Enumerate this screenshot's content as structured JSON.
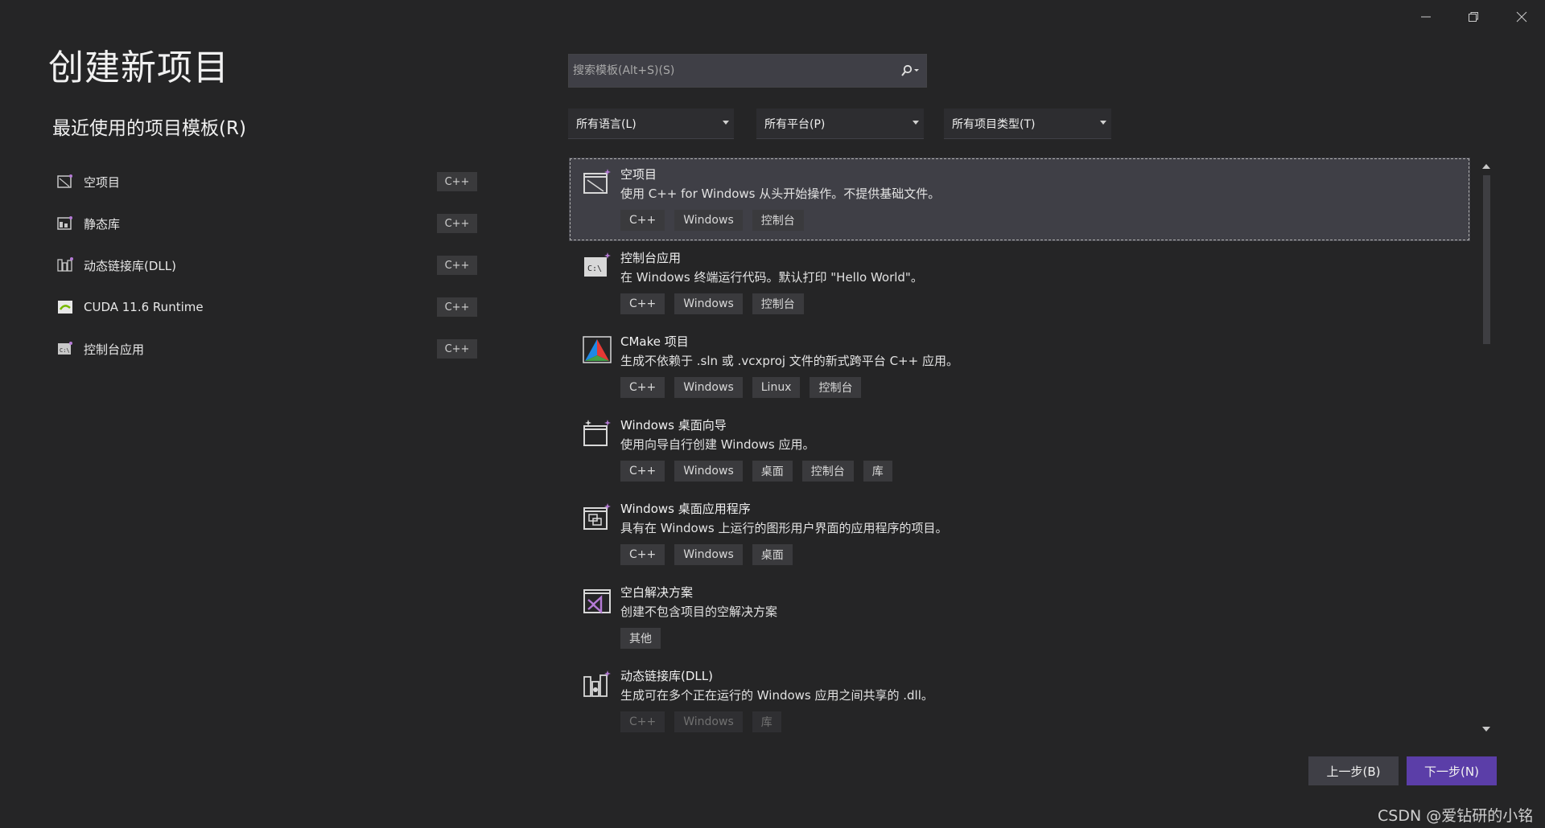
{
  "window_controls": {
    "minimize": "minimize-icon",
    "restore": "restore-icon",
    "close": "close-icon"
  },
  "page_title": "创建新项目",
  "recent": {
    "title": "最近使用的项目模板(R)",
    "items": [
      {
        "label": "空项目",
        "tag": "C++",
        "icon": "empty-project-icon"
      },
      {
        "label": "静态库",
        "tag": "C++",
        "icon": "static-library-icon"
      },
      {
        "label": "动态链接库(DLL)",
        "tag": "C++",
        "icon": "dll-icon"
      },
      {
        "label": "CUDA 11.6 Runtime",
        "tag": "C++",
        "icon": "cuda-icon"
      },
      {
        "label": "控制台应用",
        "tag": "C++",
        "icon": "console-app-icon"
      }
    ]
  },
  "search": {
    "placeholder": "搜索模板(Alt+S)(S)",
    "value": ""
  },
  "filters": {
    "language": "所有语言(L)",
    "platform": "所有平台(P)",
    "project_type": "所有项目类型(T)"
  },
  "templates": [
    {
      "name": "空项目",
      "desc": "使用 C++ for Windows 从头开始操作。不提供基础文件。",
      "tags": [
        "C++",
        "Windows",
        "控制台"
      ],
      "icon": "empty-project-icon",
      "selected": true
    },
    {
      "name": "控制台应用",
      "desc": "在 Windows 终端运行代码。默认打印 \"Hello World\"。",
      "tags": [
        "C++",
        "Windows",
        "控制台"
      ],
      "icon": "console-app-icon"
    },
    {
      "name": "CMake 项目",
      "desc": "生成不依赖于 .sln 或 .vcxproj 文件的新式跨平台 C++ 应用。",
      "tags": [
        "C++",
        "Windows",
        "Linux",
        "控制台"
      ],
      "icon": "cmake-icon"
    },
    {
      "name": "Windows 桌面向导",
      "desc": "使用向导自行创建 Windows 应用。",
      "tags": [
        "C++",
        "Windows",
        "桌面",
        "控制台",
        "库"
      ],
      "icon": "desktop-wizard-icon"
    },
    {
      "name": "Windows 桌面应用程序",
      "desc": "具有在 Windows 上运行的图形用户界面的应用程序的项目。",
      "tags": [
        "C++",
        "Windows",
        "桌面"
      ],
      "icon": "desktop-app-icon"
    },
    {
      "name": "空白解决方案",
      "desc": "创建不包含项目的空解决方案",
      "tags": [
        "其他"
      ],
      "icon": "blank-solution-icon"
    },
    {
      "name": "动态链接库(DLL)",
      "desc": "生成可在多个正在运行的 Windows 应用之间共享的 .dll。",
      "tags": [
        "C++",
        "Windows",
        "库"
      ],
      "icon": "dll-icon",
      "faded": true
    }
  ],
  "buttons": {
    "back": "上一步(B)",
    "next": "下一步(N)"
  },
  "watermark": "CSDN @爱钻研的小铭",
  "colors": {
    "background": "#252526",
    "accent": "#5b3ea8",
    "panel": "#3f3f46"
  }
}
